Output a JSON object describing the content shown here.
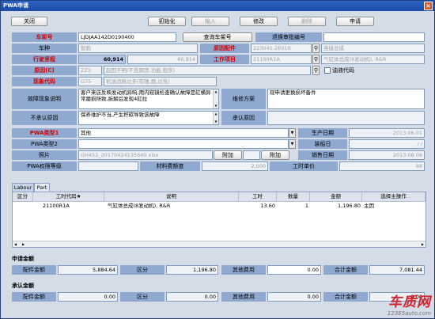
{
  "window": {
    "title": "PWA申请"
  },
  "toolbar": {
    "close": "关闭",
    "init": "初始化",
    "input": "输入",
    "modify": "修改",
    "delete": "删除",
    "apply": "申请"
  },
  "form": {
    "vin_label": "车架号",
    "vin_value": "LJDJAA142D0190400",
    "query_vin_button": "查询车架号",
    "return_approval_label": "退换审批编号",
    "return_approval_value": "",
    "model_label": "车种",
    "model_value": "智跑",
    "cause_part_label": "原因配件",
    "cause_part_value": "223041-2E010",
    "cause_part_name": "连接总成",
    "mileage_label": "行驶里程",
    "mileage_value": "60,914",
    "mileage_value2": "60,914",
    "work_item_label": "工作项目",
    "work_item_value": "21100R1A",
    "work_item_desc": "气缸体总成(8发动机), R&R",
    "cause_c_label": "原因(C)",
    "cause_c_code": "ZZ3",
    "cause_c_text": "起因不明(不良原因,功能,程序)",
    "oil_code_label": "油液代码",
    "phenomenon_code_label": "现象代码",
    "phenomenon_code": "G75",
    "phenomenon_text": "机油消耗过多(有噪,烟,过热)",
    "fault_desc_label": "故障现象说明",
    "fault_desc_value": "客户来店反映发动机异响,用内窥镜检查确认故障是缸横异常磨损所致,拆解后发现4缸拉",
    "repair_plan_label": "维修方案",
    "repair_plan_value": "现申请更换损坏备件",
    "not_approved_label": "不承认原因",
    "not_approved_value": "保养维护不当,产生积碳导致该故障",
    "approved_reason_label": "承认原因",
    "approved_reason_value": "",
    "pwa_type1_label": "PWA类型1",
    "pwa_type1_value": "其他",
    "pwa_type2_label": "PWA类型2",
    "pwa_type2_value": "",
    "photo_label": "照片",
    "photo_value": "GH452_20170424135640.xlsx",
    "attach_button1": "附加",
    "attach_button2": "附加",
    "prod_date_label": "生产日期",
    "prod_date_value": "2013.06.01",
    "install_date_label": "装船日",
    "install_date_value": "/ /",
    "sale_date_label": "销售日期",
    "sale_date_value": "2013.08.08",
    "pwa_level_label": "PWA权限等级",
    "pwa_level_value": "",
    "material_amount_label": "材料费额度",
    "material_amount_value": "2,000",
    "labor_price_label": "工时单价",
    "labor_price_value": "88"
  },
  "tabs": [
    "Labour",
    "Part"
  ],
  "grid": {
    "headers": [
      "区分",
      "工时代码★",
      "说明",
      "工时",
      "数量",
      "金额",
      "选择主操作"
    ],
    "rows": [
      {
        "type": "",
        "code": "21100R1A",
        "desc": "气缸体总成(8发动机), R&R",
        "hours": "13.60",
        "qty": "1",
        "amount": "1,196.80",
        "main": "主因"
      }
    ]
  },
  "apply_amount": {
    "title": "申请金额",
    "parts_label": "配件金额",
    "parts_value": "5,884.64",
    "type_label": "区分",
    "type_value": "1,196.80",
    "other_label": "其他费用",
    "other_value": "0.00",
    "total_label": "合计金额",
    "total_value": "7,081.44"
  },
  "approved_amount": {
    "title": "承认金额",
    "parts_label": "配件金额",
    "parts_value": "0.00",
    "type_label": "区分",
    "type_value": "0.00",
    "other_label": "其他费用",
    "other_value": "0.00",
    "total_label": "合计金额",
    "total_value": "0.00"
  },
  "watermark": {
    "logo": "车质网",
    "url": "12365auto.com"
  }
}
